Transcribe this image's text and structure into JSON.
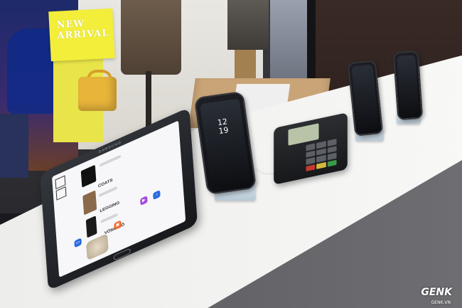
{
  "scene": {
    "description_free": true,
    "window_sign": {
      "line1": "NEW",
      "line2": "ARRIVAL"
    },
    "tablet": {
      "brand": "SAMSUNG",
      "categories": [
        "COATS",
        "LEGGING",
        "VÒNG CỔ"
      ]
    },
    "phones": [
      {
        "clock_hour": "12",
        "clock_minute": "19"
      }
    ],
    "watermark": {
      "logo": "GENK",
      "domain": "GENK.VN"
    },
    "colors": {
      "counter": "#f4f4f3",
      "phone_body": "#0c0d10",
      "sign_yellow": "#f2ee3a",
      "icon_purple": "#a44ae0",
      "icon_blue": "#2a6ae0",
      "icon_orange": "#f26a2a"
    }
  }
}
